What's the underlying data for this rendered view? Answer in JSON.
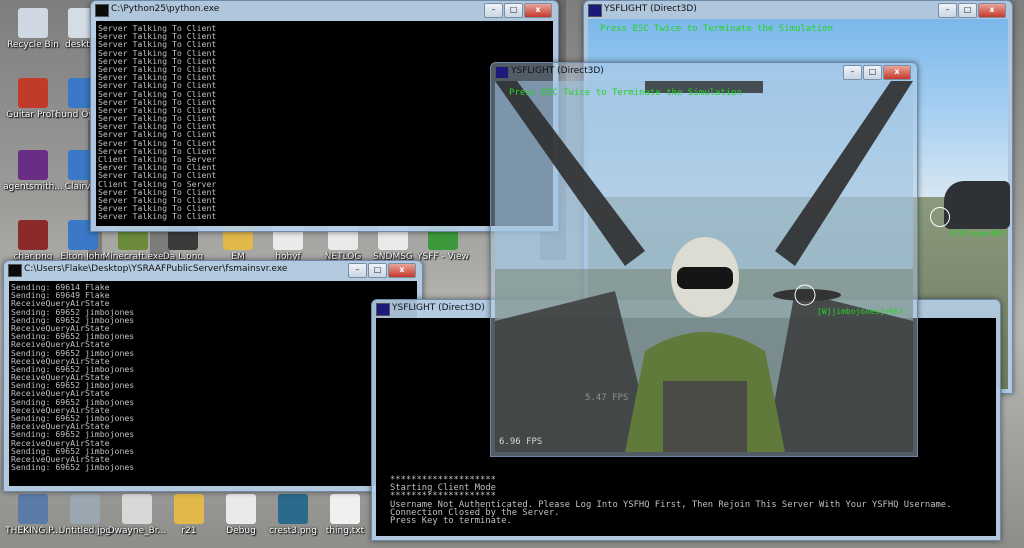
{
  "desktop": {
    "icons": [
      {
        "label": "Recycle Bin",
        "icon": "recycle-bin-icon",
        "color": "#cfd8e2"
      },
      {
        "label": "desktop",
        "icon": "shortcut-icon",
        "color": "#d4dde6"
      },
      {
        "label": "Guitar Pro 6",
        "icon": "guitar-pro-icon",
        "color": "#c23b2a"
      },
      {
        "label": "Thund Over Mi",
        "icon": "media-icon",
        "color": "#3a78c8"
      },
      {
        "label": "agentsmith...",
        "icon": "image-icon",
        "color": "#6a2d84"
      },
      {
        "label": "Clairvoy",
        "icon": "media-icon",
        "color": "#3a78c8"
      },
      {
        "label": "char.png",
        "icon": "image-icon",
        "color": "#8a2a2a"
      },
      {
        "label": "Elton John",
        "icon": "media-icon",
        "color": "#3a78c8"
      },
      {
        "label": "Minecraft.exe",
        "icon": "minecraft-icon",
        "color": "#6b8a3a"
      },
      {
        "label": "Da L.png",
        "icon": "image-icon",
        "color": "#3a3a3a"
      },
      {
        "label": "EM",
        "icon": "folder-icon",
        "color": "#e2b84a"
      },
      {
        "label": "hohyf",
        "icon": "file-icon",
        "color": "#eaeaea"
      },
      {
        "label": "NETLOG",
        "icon": "file-icon",
        "color": "#eaeaea"
      },
      {
        "label": "SNDMSG",
        "icon": "file-icon",
        "color": "#eaeaea"
      },
      {
        "label": "YSFF - View",
        "icon": "chrome-icon",
        "color": "#3c9a3c"
      },
      {
        "label": "THEKING.P...",
        "icon": "image-icon",
        "color": "#5a7aa8"
      },
      {
        "label": "Untitled.jpg",
        "icon": "image-icon",
        "color": "#9aa6b0"
      },
      {
        "label": "Dwayne_Br...",
        "icon": "pdf-icon",
        "color": "#d8d8d8"
      },
      {
        "label": "r21",
        "icon": "zip-folder-icon",
        "color": "#e2b84a"
      },
      {
        "label": "Debug",
        "icon": "file-icon",
        "color": "#eaeaea"
      },
      {
        "label": "crest3.png",
        "icon": "image-icon",
        "color": "#2a6a8a"
      },
      {
        "label": "thing.txt",
        "icon": "text-file-icon",
        "color": "#f0f0f0"
      }
    ]
  },
  "python_window": {
    "title": "C:\\Python25\\python.exe",
    "lines": [
      "Server Talking To Client",
      "Server Talking To Client",
      "Server Talking To Client",
      "Server Talking To Client",
      "Server Talking To Client",
      "Server Talking To Client",
      "Server Talking To Client",
      "Server Talking To Client",
      "Server Talking To Client",
      "Server Talking To Client",
      "Server Talking To Client",
      "Server Talking To Client",
      "Server Talking To Client",
      "Server Talking To Client",
      "Server Talking To Client",
      "Server Talking To Client",
      "Client Talking To Server",
      "Server Talking To Client",
      "Server Talking To Client",
      "Client Talking To Server",
      "Server Talking To Client",
      "Server Talking To Client",
      "Server Talking To Client",
      "Server Talking To Client"
    ]
  },
  "fsmain_window": {
    "title": "C:\\Users\\Flake\\Desktop\\YSRAAFPublicServer\\fsmainsvr.exe",
    "lines": [
      "Sending: 69614 Flake",
      "Sending: 69649 Flake",
      "ReceiveQueryAirState",
      "Sending: 69652 jimbojones",
      "Sending: 69652 jimbojones",
      "ReceiveQueryAirState",
      "Sending: 69652 jimbojones",
      "ReceiveQueryAirState",
      "Sending: 69652 jimbojones",
      "ReceiveQueryAirState",
      "Sending: 69652 jimbojones",
      "ReceiveQueryAirState",
      "Sending: 69652 jimbojones",
      "ReceiveQueryAirState",
      "Sending: 69652 jimbojones",
      "ReceiveQueryAirState",
      "Sending: 69652 jimbojones",
      "ReceiveQueryAirState",
      "Sending: 69652 jimbojones",
      "ReceiveQueryAirState",
      "Sending: 69652 jimbojones",
      "ReceiveQueryAirState",
      "Sending: 69652 jimbojones"
    ]
  },
  "ysflight_right": {
    "title": "YSFLIGHT (Direct3D)",
    "hint": "Press ESC Twice to Terminate the Simulation",
    "tag": "[F]Flake+0kt"
  },
  "ysflight_main": {
    "title": "YSFLIGHT (Direct3D)",
    "hint": "Press ESC Twice to Terminate the Simulation",
    "tag": "[W]jimbojones]+0kt",
    "fps": "6.96 FPS",
    "fps_ghost": "5.47 FPS"
  },
  "ysflight_console": {
    "title": "YSFLIGHT (Direct3D)",
    "lines": [
      "********************",
      "Starting Client Mode",
      "********************",
      "Username Not Authenticated. Please Log Into YSFHQ First, Then Rejoin This Server With Your YSFHQ Username.",
      "Connection Closed by the Server.",
      "Press Key to terminate."
    ]
  },
  "controls": {
    "min": "–",
    "max": "□",
    "close": "x"
  }
}
